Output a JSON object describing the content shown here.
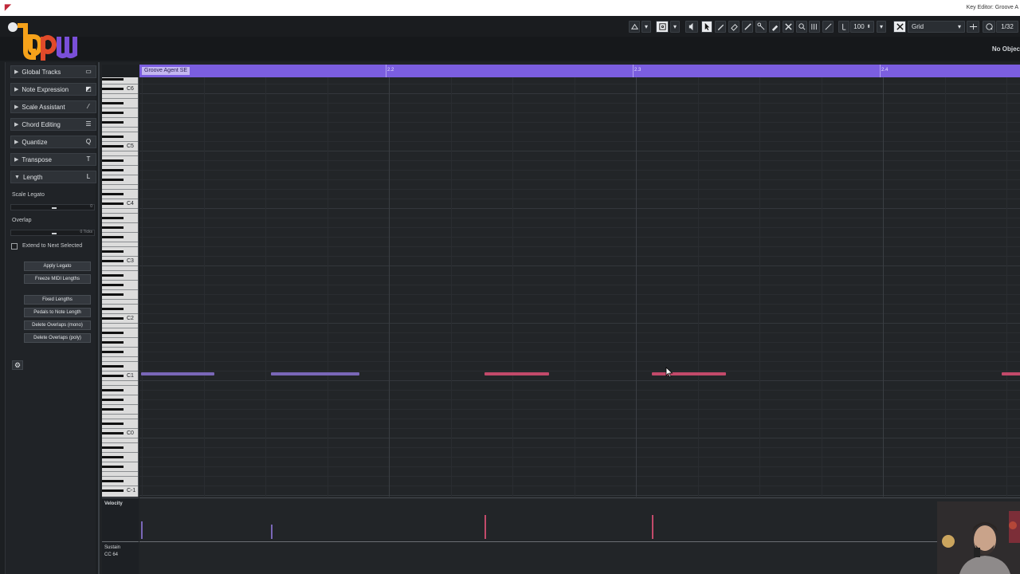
{
  "window": {
    "title": "Key Editor: Groove A"
  },
  "toolbar": {
    "quantize_value": "100",
    "snap_mode": "Grid",
    "quantize_preset": "1/32"
  },
  "info_line": {
    "status": "No Objec"
  },
  "inspector": {
    "sections": [
      {
        "label": "Global Tracks",
        "icon": "panel-icon"
      },
      {
        "label": "Note Expression",
        "icon": "expression-icon"
      },
      {
        "label": "Scale Assistant",
        "icon": "scale-icon"
      },
      {
        "label": "Chord Editing",
        "icon": "chord-icon"
      },
      {
        "label": "Quantize",
        "icon": "Q"
      },
      {
        "label": "Transpose",
        "icon": "T"
      },
      {
        "label": "Length",
        "icon": "L"
      }
    ],
    "length": {
      "scale_legato_label": "Scale Legato",
      "scale_legato_value": "0",
      "overlap_label": "Overlap",
      "overlap_value": "0 Ticks",
      "extend_label": "Extend to Next Selected",
      "extend_checked": false,
      "buttons": [
        "Apply Legato",
        "Freeze MIDI Lengths",
        "Fixed Lengths",
        "Pedals to Note Length",
        "Delete Overlaps (mono)",
        "Delete Overlaps (poly)"
      ]
    }
  },
  "editor": {
    "part_name": "Groove Agent SE",
    "ruler_markers": [
      "2.2",
      "2.3",
      "2.4"
    ],
    "octave_labels": [
      "C6",
      "C5",
      "C4",
      "C3",
      "C2",
      "C1",
      "C0",
      "C-1"
    ],
    "notes": [
      {
        "color": "#7a67b8"
      },
      {
        "color": "#7a67b8"
      },
      {
        "color": "#c24a6a"
      },
      {
        "color": "#c24a6a"
      },
      {
        "color": "#c24a6a"
      }
    ],
    "lanes": {
      "velocity_label": "Velocity",
      "sustain_label": "Sustain",
      "sustain_cc": "CC 64"
    }
  },
  "colors": {
    "accent": "#7b5ee0",
    "note_purple": "#7a67b8",
    "note_red": "#c24a6a"
  }
}
